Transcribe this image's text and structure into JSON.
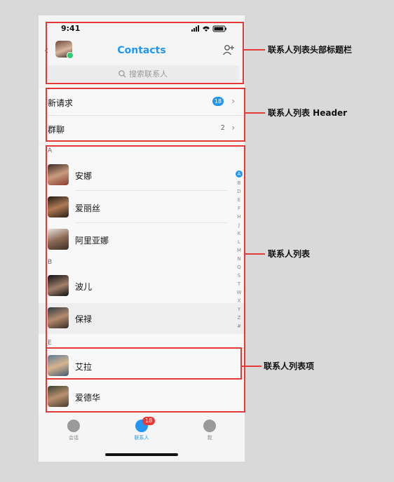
{
  "status": {
    "time": "9:41"
  },
  "nav": {
    "title": "Contacts"
  },
  "search": {
    "placeholder": "搜索联系人"
  },
  "header_rows": [
    {
      "label": "新请求",
      "badge": "18"
    },
    {
      "label": "群聊",
      "count": "2"
    }
  ],
  "contacts": {
    "section_a": "A",
    "section_b": "B",
    "section_e": "E",
    "items": [
      {
        "name": "安娜"
      },
      {
        "name": "爱丽丝"
      },
      {
        "name": "阿里亚娜"
      },
      {
        "name": "波儿"
      },
      {
        "name": "保禄"
      },
      {
        "name": "艾拉"
      },
      {
        "name": "爱德华"
      }
    ]
  },
  "index": [
    "A",
    "B",
    "D",
    "E",
    "F",
    "H",
    "J",
    "K",
    "L",
    "M",
    "N",
    "Q",
    "S",
    "T",
    "W",
    "X",
    "Y",
    "Z",
    "#"
  ],
  "tabbar": {
    "chat": "会话",
    "contacts": "联系人",
    "me": "我",
    "badge": "18"
  },
  "annotations": {
    "header_bar": "联系人列表头部标题栏",
    "list_header": "联系人列表 Header",
    "list": "联系人列表",
    "list_item": "联系人列表项"
  },
  "colors": {
    "accent": "#2196f3",
    "annotation": "#e53935"
  }
}
